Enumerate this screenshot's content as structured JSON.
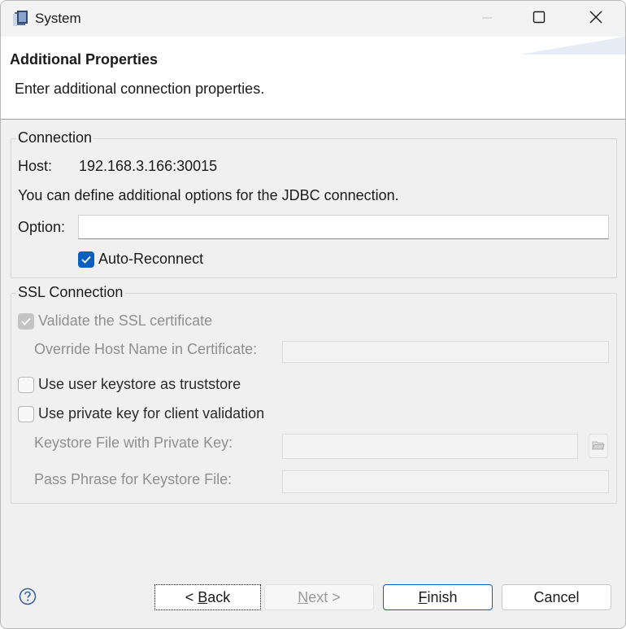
{
  "window": {
    "title": "System"
  },
  "banner": {
    "title": "Additional Properties",
    "description": "Enter additional connection properties."
  },
  "connection": {
    "group_title": "Connection",
    "host_label": "Host:",
    "host_value": "192.168.3.166:30015",
    "info_text": "You can define additional options for the JDBC connection.",
    "option_label": "Option:",
    "option_value": "",
    "auto_reconnect_label": "Auto-Reconnect",
    "auto_reconnect_checked": true
  },
  "ssl": {
    "group_title": "SSL Connection",
    "validate_label": "Validate the SSL certificate",
    "override_label": "Override Host Name in Certificate:",
    "override_value": "",
    "user_keystore_label": "Use user keystore as truststore",
    "private_key_label": "Use private key for client validation",
    "keystore_file_label": "Keystore File with Private Key:",
    "keystore_file_value": "",
    "pass_phrase_label": "Pass Phrase for Keystore File:",
    "pass_phrase_value": ""
  },
  "buttons": {
    "back_prefix": "< ",
    "back_mnemonic": "B",
    "back_rest": "ack",
    "next_mnemonic": "N",
    "next_rest": "ext >",
    "finish_mnemonic": "F",
    "finish_rest": "inish",
    "cancel": "Cancel"
  },
  "icons": {
    "app": "eclipse-window-icon",
    "minimize": "minimize-icon",
    "maximize": "maximize-icon",
    "close": "close-icon",
    "help": "help-icon",
    "browse": "folder-open-icon"
  },
  "colors": {
    "accent": "#0a5fbf",
    "disabled_text": "#8f8f8f"
  }
}
